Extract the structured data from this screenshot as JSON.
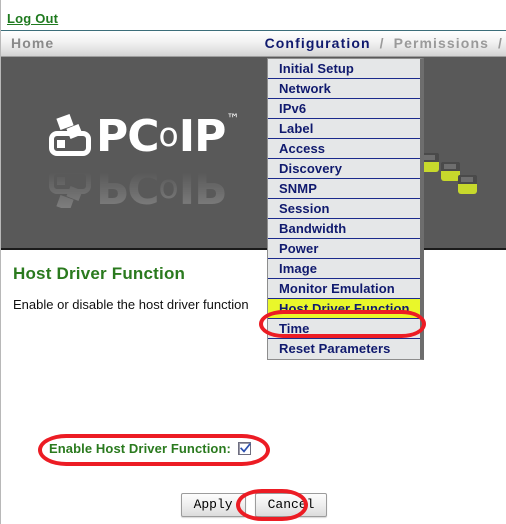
{
  "header": {
    "logout_label": "Log Out"
  },
  "nav": {
    "home_label": "Home",
    "active_label": "Configuration",
    "separator": "/",
    "next_label": "Permissions",
    "trailing_separator": "/"
  },
  "banner": {
    "logo_prefix": "PC",
    "logo_o": "o",
    "logo_suffix": "IP",
    "logo_tm": "™"
  },
  "menu": {
    "items": [
      {
        "label": "Initial Setup",
        "highlighted": false
      },
      {
        "label": "Network",
        "highlighted": false
      },
      {
        "label": "IPv6",
        "highlighted": false
      },
      {
        "label": "Label",
        "highlighted": false
      },
      {
        "label": "Access",
        "highlighted": false
      },
      {
        "label": "Discovery",
        "highlighted": false
      },
      {
        "label": "SNMP",
        "highlighted": false
      },
      {
        "label": "Session",
        "highlighted": false
      },
      {
        "label": "Bandwidth",
        "highlighted": false
      },
      {
        "label": "Power",
        "highlighted": false
      },
      {
        "label": "Image",
        "highlighted": false
      },
      {
        "label": "Monitor Emulation",
        "highlighted": false
      },
      {
        "label": "Host Driver Function",
        "highlighted": true
      },
      {
        "label": "Time",
        "highlighted": false
      },
      {
        "label": "Reset Parameters",
        "highlighted": false
      }
    ]
  },
  "main": {
    "title": "Host Driver Function",
    "description": "Enable or disable the host driver function",
    "checkbox_label": "Enable Host Driver Function:",
    "checkbox_checked": true,
    "apply_label": "Apply",
    "cancel_label": "Cancel"
  },
  "colors": {
    "link_green": "#1f7a1f",
    "title_green": "#2a7a1e",
    "menu_navy": "#101a6e",
    "highlight_yellow": "#e9f72a",
    "annotation_red": "#ec1c24",
    "banner_gray": "#595959",
    "cube_green": "#c7d92c"
  }
}
